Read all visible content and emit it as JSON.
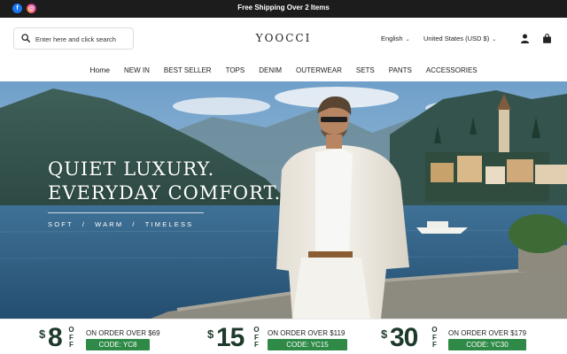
{
  "topbar": {
    "message": "Free Shipping Over 2 Items",
    "social": [
      "facebook-icon",
      "instagram-icon"
    ]
  },
  "header": {
    "search_placeholder": "Enter here and click search",
    "logo": "YOOCCI",
    "language": "English",
    "currency": "United States (USD $)",
    "icons": [
      "search-icon",
      "account-icon",
      "shopping-bag-icon"
    ]
  },
  "nav": {
    "items": [
      "Home",
      "NEW IN",
      "BEST SELLER",
      "TOPS",
      "DENIM",
      "OUTERWEAR",
      "SETS",
      "PANTS",
      "ACCESSORIES"
    ]
  },
  "hero": {
    "headline_1": "QUIET LUXURY.",
    "headline_2": "EVERYDAY COMFORT.",
    "tags": [
      "SOFT",
      "WARM",
      "TIMELESS"
    ],
    "separator": "/"
  },
  "coupons": [
    {
      "currency": "$",
      "amount": "8",
      "off": "OFF",
      "condition": "ON ORDER OVER $69",
      "code": "CODE: YC8"
    },
    {
      "currency": "$",
      "amount": "15",
      "off": "OFF",
      "condition": "ON ORDER OVER $119",
      "code": "CODE: YC15"
    },
    {
      "currency": "$",
      "amount": "30",
      "off": "OFF",
      "condition": "ON ORDER OVER $179",
      "code": "CODE: YC30"
    }
  ],
  "colors": {
    "topbar_bg": "#1c1c1c",
    "coupon_green": "#2f8a48",
    "coupon_text": "#1e3a2a"
  }
}
